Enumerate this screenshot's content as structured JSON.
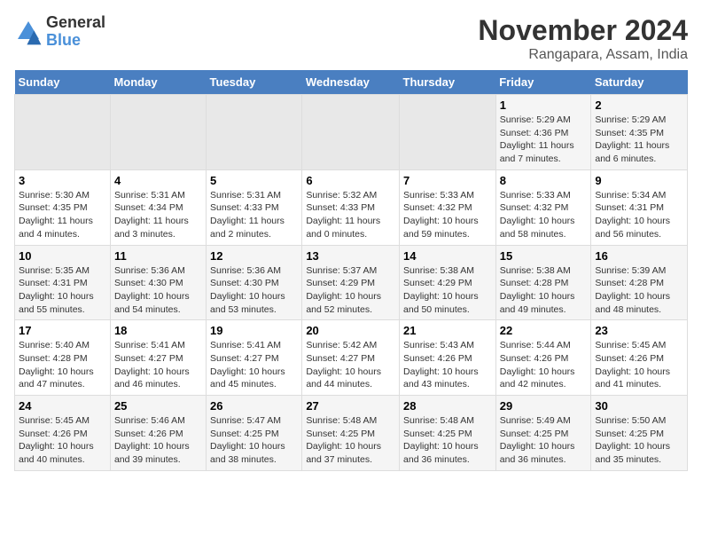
{
  "logo": {
    "general": "General",
    "blue": "Blue"
  },
  "title": "November 2024",
  "location": "Rangapara, Assam, India",
  "days_of_week": [
    "Sunday",
    "Monday",
    "Tuesday",
    "Wednesday",
    "Thursday",
    "Friday",
    "Saturday"
  ],
  "weeks": [
    [
      {
        "day": "",
        "info": ""
      },
      {
        "day": "",
        "info": ""
      },
      {
        "day": "",
        "info": ""
      },
      {
        "day": "",
        "info": ""
      },
      {
        "day": "",
        "info": ""
      },
      {
        "day": "1",
        "info": "Sunrise: 5:29 AM\nSunset: 4:36 PM\nDaylight: 11 hours\nand 7 minutes."
      },
      {
        "day": "2",
        "info": "Sunrise: 5:29 AM\nSunset: 4:35 PM\nDaylight: 11 hours\nand 6 minutes."
      }
    ],
    [
      {
        "day": "3",
        "info": "Sunrise: 5:30 AM\nSunset: 4:35 PM\nDaylight: 11 hours\nand 4 minutes."
      },
      {
        "day": "4",
        "info": "Sunrise: 5:31 AM\nSunset: 4:34 PM\nDaylight: 11 hours\nand 3 minutes."
      },
      {
        "day": "5",
        "info": "Sunrise: 5:31 AM\nSunset: 4:33 PM\nDaylight: 11 hours\nand 2 minutes."
      },
      {
        "day": "6",
        "info": "Sunrise: 5:32 AM\nSunset: 4:33 PM\nDaylight: 11 hours\nand 0 minutes."
      },
      {
        "day": "7",
        "info": "Sunrise: 5:33 AM\nSunset: 4:32 PM\nDaylight: 10 hours\nand 59 minutes."
      },
      {
        "day": "8",
        "info": "Sunrise: 5:33 AM\nSunset: 4:32 PM\nDaylight: 10 hours\nand 58 minutes."
      },
      {
        "day": "9",
        "info": "Sunrise: 5:34 AM\nSunset: 4:31 PM\nDaylight: 10 hours\nand 56 minutes."
      }
    ],
    [
      {
        "day": "10",
        "info": "Sunrise: 5:35 AM\nSunset: 4:31 PM\nDaylight: 10 hours\nand 55 minutes."
      },
      {
        "day": "11",
        "info": "Sunrise: 5:36 AM\nSunset: 4:30 PM\nDaylight: 10 hours\nand 54 minutes."
      },
      {
        "day": "12",
        "info": "Sunrise: 5:36 AM\nSunset: 4:30 PM\nDaylight: 10 hours\nand 53 minutes."
      },
      {
        "day": "13",
        "info": "Sunrise: 5:37 AM\nSunset: 4:29 PM\nDaylight: 10 hours\nand 52 minutes."
      },
      {
        "day": "14",
        "info": "Sunrise: 5:38 AM\nSunset: 4:29 PM\nDaylight: 10 hours\nand 50 minutes."
      },
      {
        "day": "15",
        "info": "Sunrise: 5:38 AM\nSunset: 4:28 PM\nDaylight: 10 hours\nand 49 minutes."
      },
      {
        "day": "16",
        "info": "Sunrise: 5:39 AM\nSunset: 4:28 PM\nDaylight: 10 hours\nand 48 minutes."
      }
    ],
    [
      {
        "day": "17",
        "info": "Sunrise: 5:40 AM\nSunset: 4:28 PM\nDaylight: 10 hours\nand 47 minutes."
      },
      {
        "day": "18",
        "info": "Sunrise: 5:41 AM\nSunset: 4:27 PM\nDaylight: 10 hours\nand 46 minutes."
      },
      {
        "day": "19",
        "info": "Sunrise: 5:41 AM\nSunset: 4:27 PM\nDaylight: 10 hours\nand 45 minutes."
      },
      {
        "day": "20",
        "info": "Sunrise: 5:42 AM\nSunset: 4:27 PM\nDaylight: 10 hours\nand 44 minutes."
      },
      {
        "day": "21",
        "info": "Sunrise: 5:43 AM\nSunset: 4:26 PM\nDaylight: 10 hours\nand 43 minutes."
      },
      {
        "day": "22",
        "info": "Sunrise: 5:44 AM\nSunset: 4:26 PM\nDaylight: 10 hours\nand 42 minutes."
      },
      {
        "day": "23",
        "info": "Sunrise: 5:45 AM\nSunset: 4:26 PM\nDaylight: 10 hours\nand 41 minutes."
      }
    ],
    [
      {
        "day": "24",
        "info": "Sunrise: 5:45 AM\nSunset: 4:26 PM\nDaylight: 10 hours\nand 40 minutes."
      },
      {
        "day": "25",
        "info": "Sunrise: 5:46 AM\nSunset: 4:26 PM\nDaylight: 10 hours\nand 39 minutes."
      },
      {
        "day": "26",
        "info": "Sunrise: 5:47 AM\nSunset: 4:25 PM\nDaylight: 10 hours\nand 38 minutes."
      },
      {
        "day": "27",
        "info": "Sunrise: 5:48 AM\nSunset: 4:25 PM\nDaylight: 10 hours\nand 37 minutes."
      },
      {
        "day": "28",
        "info": "Sunrise: 5:48 AM\nSunset: 4:25 PM\nDaylight: 10 hours\nand 36 minutes."
      },
      {
        "day": "29",
        "info": "Sunrise: 5:49 AM\nSunset: 4:25 PM\nDaylight: 10 hours\nand 36 minutes."
      },
      {
        "day": "30",
        "info": "Sunrise: 5:50 AM\nSunset: 4:25 PM\nDaylight: 10 hours\nand 35 minutes."
      }
    ]
  ]
}
